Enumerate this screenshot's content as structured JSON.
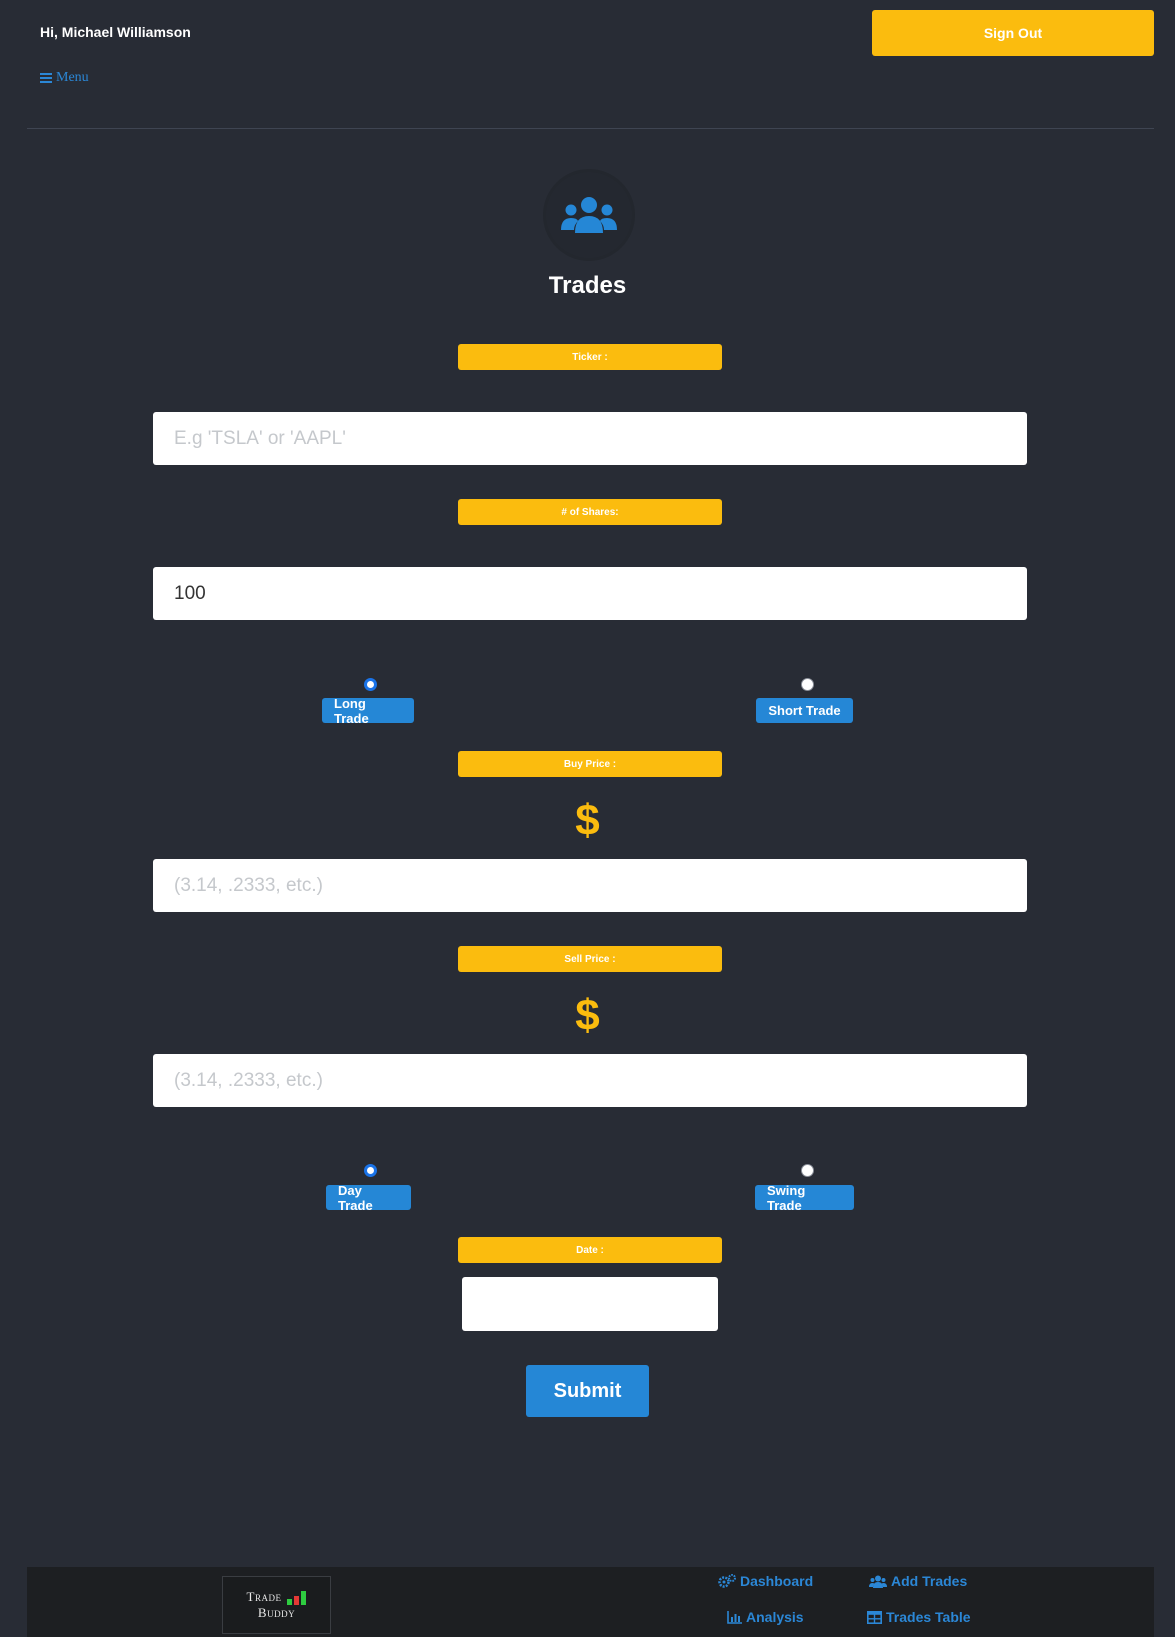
{
  "header": {
    "greeting": "Hi, Michael Williamson",
    "sign_out": "Sign Out",
    "menu": "Menu"
  },
  "page": {
    "title": "Trades"
  },
  "form": {
    "ticker_label": "Ticker :",
    "ticker_placeholder": "E.g 'TSLA' or 'AAPL'",
    "shares_label": "# of Shares:",
    "shares_value": "100",
    "long_trade": "Long Trade",
    "short_trade": "Short Trade",
    "buy_price_label": "Buy Price :",
    "dollar_sign": "$",
    "buy_price_placeholder": "(3.14, .2333, etc.)",
    "sell_price_label": "Sell Price :",
    "sell_price_placeholder": "(3.14, .2333, etc.)",
    "day_trade": "Day Trade",
    "swing_trade": "Swing Trade",
    "date_label": "Date :",
    "submit": "Submit"
  },
  "footer": {
    "logo_line1": "Trade",
    "logo_line2": "Buddy",
    "links": {
      "dashboard": "Dashboard",
      "add_trades": "Add Trades",
      "analysis": "Analysis",
      "trades_table": "Trades Table"
    }
  },
  "colors": {
    "background": "#282c35",
    "accent_yellow": "#fbbc0e",
    "accent_blue": "#2587d6",
    "footer_background": "#1d1f22"
  }
}
